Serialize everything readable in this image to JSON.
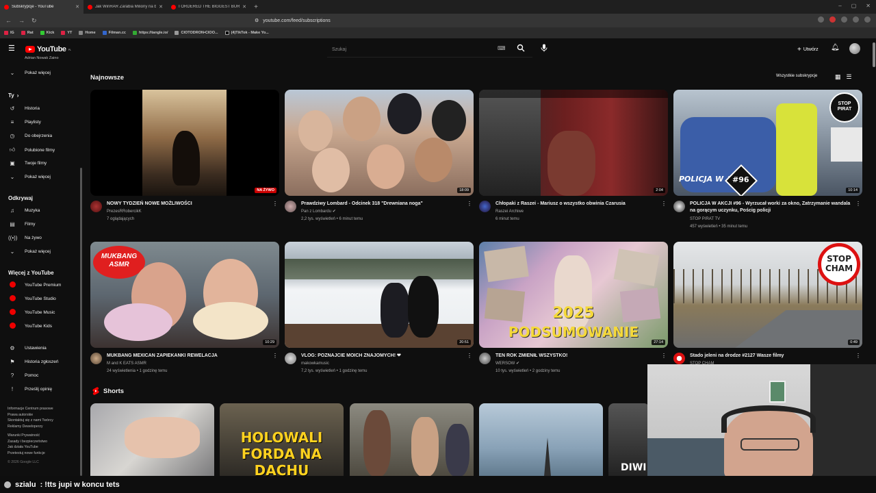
{
  "browser": {
    "tabs": [
      {
        "title": "Subskrypcje - YouTube",
        "active": true
      },
      {
        "title": "Jak WinRAR Zarabia Miliony na bycz..."
      },
      {
        "title": "I ORDERED THE BIGGEST BURGER IN..."
      }
    ],
    "url": "youtube.com/feed/subscriptions",
    "bookmarks": [
      "IG",
      "Rat",
      "Kick",
      "YT",
      "Home",
      "Filman.cc",
      "https://tangle.io/",
      "CIOTODRON•CIOO...",
      "(4)TikTok - Make Yo..."
    ]
  },
  "header": {
    "logo_text": "YouTube",
    "logo_region": "PL",
    "search_placeholder": "Szukaj",
    "create_label": "Utwórz"
  },
  "sidebar": {
    "top_partial": "Adrian Nowak Zaino",
    "show_more_top": "Pokaż więcej",
    "you_section": "Ty",
    "you_items": [
      {
        "icon": "history-icon",
        "label": "Historia"
      },
      {
        "icon": "playlist-icon",
        "label": "Playlisty"
      },
      {
        "icon": "watch-later-icon",
        "label": "Do obejrzenia"
      },
      {
        "icon": "liked-icon",
        "label": "Polubione filmy"
      },
      {
        "icon": "your-videos-icon",
        "label": "Twoje filmy"
      },
      {
        "icon": "chevron-down-icon",
        "label": "Pokaż więcej"
      }
    ],
    "explore_section": "Odkrywaj",
    "explore_items": [
      {
        "icon": "music-icon",
        "label": "Muzyka"
      },
      {
        "icon": "film-icon",
        "label": "Filmy"
      },
      {
        "icon": "live-icon",
        "label": "Na żywo"
      },
      {
        "icon": "chevron-down-icon",
        "label": "Pokaż więcej"
      }
    ],
    "more_section": "Więcej z YouTube",
    "more_items": [
      "YouTube Premium",
      "YouTube Studio",
      "YouTube Music",
      "YouTube Kids"
    ],
    "settings_items": [
      {
        "icon": "gear-icon",
        "label": "Ustawienia"
      },
      {
        "icon": "flag-icon",
        "label": "Historia zgłoszeń"
      },
      {
        "icon": "help-icon",
        "label": "Pomoc"
      },
      {
        "icon": "feedback-icon",
        "label": "Prześlij opinię"
      }
    ],
    "footer_lines": [
      "Informacje  Centrum prasowe",
      "Prawa autorskie",
      "Skontaktuj się z nami  Twórcy",
      "Reklamy  Deweloperzy",
      "",
      "Warunki  Prywatność",
      "Zasady i bezpieczeństwo",
      "Jak działa YouTube",
      "Przetestuj nowe funkcje",
      "",
      "© 2026 Google LLC"
    ]
  },
  "main": {
    "section_title": "Najnowsze",
    "all_subscriptions": "Wszystkie subskrypcje",
    "videos": [
      {
        "title": "NOWY TYDZIEŃ NOWE MOŻLIWOŚCI",
        "channel": "PrezesRRobercikK",
        "meta": "7 oglądających",
        "badge": "NA ŻYWO"
      },
      {
        "title": "Prawdziwy Lombard - Odcinek 318 \"Drewniana noga\"",
        "channel": "Pan z Lombardu ✔",
        "meta": "2,2 tys. wyświetleń • 6 minut temu",
        "duration": "18:09"
      },
      {
        "title": "Chłopaki z Raszei - Mariusz o wszystko obwinia Czarusia",
        "channel": "Raszei Archiwe",
        "meta": "6 minut temu",
        "duration": "2:04"
      },
      {
        "title": "POLICJA W AKCJI #96 - Wyrzucał worki za okno, Zatrzymanie wandala na gorącym uczynku, Pościg policji",
        "channel": "STOP PIRAT TV",
        "meta": "457 wyświetleń • 35 minut temu",
        "duration": "10:14"
      },
      {
        "title": "MUKBANG MEXICAN ZAPIEKANKI REWELACJA",
        "channel": "M and K EATS ASMR",
        "meta": "24 wyświetlenia • 1 godzinę temu",
        "duration": "10:29"
      },
      {
        "title": "VLOG: POZNAJCIE MOICH ZNAJOMYCH! ❤",
        "channel": "makowkamusic",
        "meta": "7,2 tys. wyświetleń • 1 godzinę temu",
        "duration": "20:51"
      },
      {
        "title": "TEN ROK ZMIENIŁ WSZYSTKO!",
        "channel": "WERSOW ✔",
        "meta": "10 tys. wyświetleń • 2 godziny temu",
        "duration": "27:14"
      },
      {
        "title": "Stado jeleni na drodze #2127 Wasze filmy",
        "channel": "STOP CHAM",
        "meta": "",
        "duration": "0:49"
      }
    ],
    "thumb_texts": {
      "mukbang": "MUKBANG ASMR",
      "policja": "POLICJA W AKCJI",
      "policja_num": "#96",
      "stop_pirat": "STOP PIRAT",
      "podsumowanie_year": "2025",
      "podsumowanie": "PODSUMOWANIE",
      "stop_cham": "STOP CHAM"
    },
    "shorts_title": "Shorts",
    "shorts_texts": [
      "",
      "HOLOWALI FORDA NA DACHU",
      "",
      "",
      "DIWI"
    ]
  },
  "chat": {
    "user": "szialu",
    "message": ": !tts jupi w koncu tets"
  },
  "colors": {
    "bg": "#0f0f0f",
    "brand": "#ff0000",
    "live": "#cc0000"
  }
}
